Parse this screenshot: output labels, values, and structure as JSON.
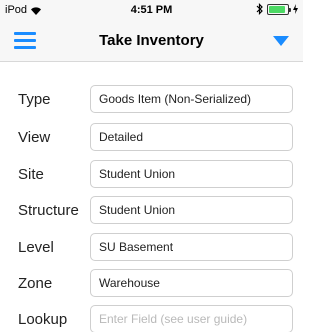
{
  "status_bar": {
    "carrier": "iPod",
    "time": "4:51 PM",
    "icons": [
      "wifi-icon",
      "bluetooth-icon",
      "battery-icon",
      "charging-icon"
    ],
    "battery_level": 0.9
  },
  "nav": {
    "title": "Take Inventory",
    "menu_icon": "hamburger-menu-icon",
    "dropdown_icon": "dropdown-triangle-icon",
    "accent_color": "#1a8cff"
  },
  "form": {
    "type": {
      "label": "Type",
      "value": "Goods Item (Non-Serialized)"
    },
    "view": {
      "label": "View",
      "value": "Detailed"
    },
    "site": {
      "label": "Site",
      "value": "Student Union"
    },
    "structure": {
      "label": "Structure",
      "value": "Student Union"
    },
    "level": {
      "label": "Level",
      "value": "SU Basement"
    },
    "zone": {
      "label": "Zone",
      "value": "Warehouse"
    },
    "lookup": {
      "label": "Lookup",
      "placeholder": "Enter Field (see user guide)"
    }
  }
}
